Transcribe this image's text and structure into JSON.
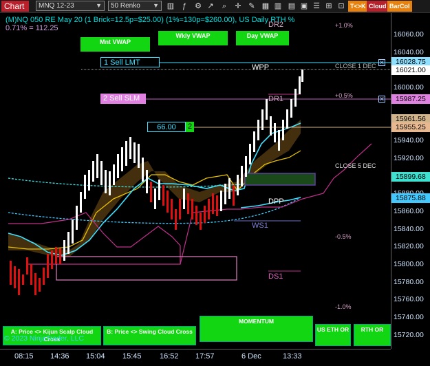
{
  "toolbar": {
    "title": "Chart",
    "instrument": "MNQ 12-23",
    "bar_type": "50 Renko",
    "buttons": {
      "tk": "T<>K",
      "cloud": "Cloud",
      "barcol": "BarCol"
    }
  },
  "header": {
    "line1": "(M)NQ 050 RE May 20 (1 Brick=12.5p=$25.00) (1%=130p=$260.00), US Daily RTH %",
    "line2": "0.71% = 112.25"
  },
  "vwap_buttons": {
    "month": "Mnt VWAP",
    "weekly": "Wkly VWAP",
    "day": "Day VWAP"
  },
  "orders": {
    "sell_lmt": {
      "label": "1 Sell LMT",
      "price": "16028.75"
    },
    "sell_slm": {
      "label": "2 Sell SLM",
      "price": "15987.25"
    },
    "position": {
      "value": "66.00",
      "qty": "2"
    }
  },
  "levels": {
    "wpp": "WPP",
    "dr1": "DR1",
    "dr2": "DR2",
    "dpp": "DPP",
    "ws1": "WS1",
    "ds1": "DS1",
    "close1": "CLOSE 1 DEC",
    "close5": "CLOSE 5 DEC"
  },
  "pct_labels": {
    "p1": "+1.0%",
    "p05": "+0.5%",
    "m05": "-0.5%",
    "m1": "-1.0%"
  },
  "price_axis": {
    "ticks": [
      "16060.00",
      "16040.00",
      "16000.00",
      "15940.00",
      "15920.00",
      "15900.00",
      "15880.00",
      "15860.00",
      "15840.00",
      "15820.00",
      "15800.00",
      "15780.00",
      "15760.00",
      "15740.00",
      "15720.00"
    ],
    "flags": {
      "f1": {
        "text": "16028.75",
        "color": "#000000",
        "bg": "#8fe0ff"
      },
      "f2": {
        "text": "16021.00",
        "color": "#000000",
        "bg": "#ffffff"
      },
      "f3": {
        "text": "15987.25",
        "color": "#000000",
        "bg": "#e080e0"
      },
      "f4": {
        "text": "15961.56",
        "color": "#000000",
        "bg": "#d2b48c"
      },
      "f5": {
        "text": "15955.25",
        "color": "#000000",
        "bg": "#e8b890"
      },
      "f6": {
        "text": "15899.68",
        "color": "#000000",
        "bg": "#40e0d0"
      },
      "f7": {
        "text": "15875.88",
        "color": "#000000",
        "bg": "#40c8ff"
      }
    }
  },
  "time_axis": [
    "08:15",
    "14:36",
    "15:04",
    "15:45",
    "16:52",
    "17:57",
    "6 Dec",
    "13:33"
  ],
  "bottom_buttons": {
    "scalp": "A: Price <> Kijun Scalp Cloud Cross",
    "swing": "B: Price <> Swing Cloud Cross",
    "momentum": "MOMENTUM",
    "eth": "US ETH OR",
    "rth": "RTH OR"
  },
  "watermark": "© 2023 NinjaTrader, LLC",
  "colors": {
    "up_brick": "#ffffff",
    "down_brick": "#e01010",
    "cloud": "#6b4a1a",
    "kijun": "#ffd700",
    "tenkan": "#40e0ff",
    "pivot": "#c0308a"
  }
}
